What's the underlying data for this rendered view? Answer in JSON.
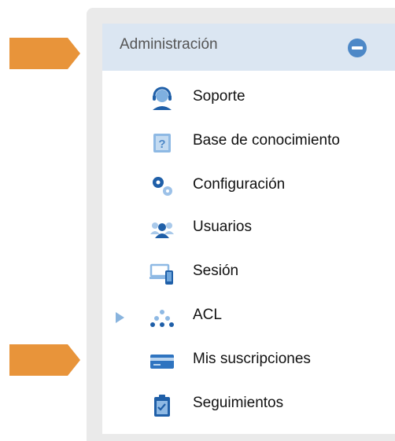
{
  "menu": {
    "title": "Administración",
    "items": [
      {
        "label": "Soporte",
        "icon": "headset-agent-icon"
      },
      {
        "label": "Base de conocimiento",
        "icon": "question-book-icon"
      },
      {
        "label": "Configuración",
        "icon": "gears-icon"
      },
      {
        "label": "Usuarios",
        "icon": "users-icon"
      },
      {
        "label": "Sesión",
        "icon": "devices-icon"
      },
      {
        "label": "ACL",
        "icon": "nodes-icon"
      },
      {
        "label": "Mis suscripciones",
        "icon": "credit-card-icon"
      },
      {
        "label": "Seguimientos",
        "icon": "clipboard-check-icon"
      }
    ]
  },
  "colors": {
    "header_bg": "#dbe6f2",
    "accent": "#4d88c7",
    "arrow": "#e8943a"
  }
}
